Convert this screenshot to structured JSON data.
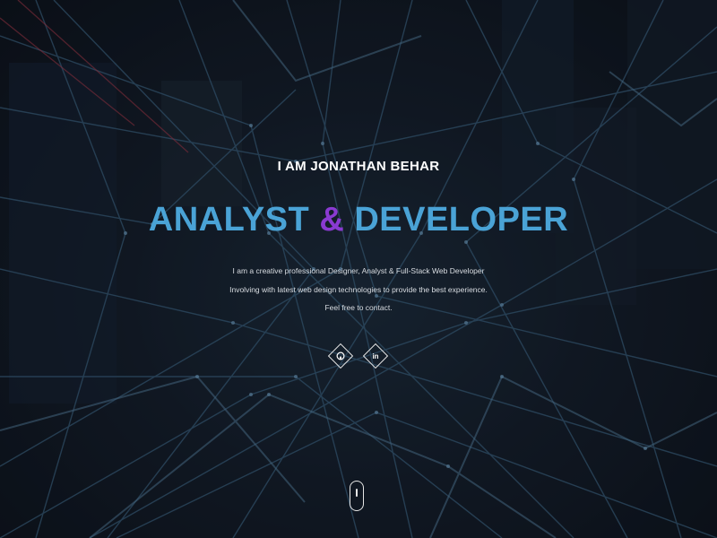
{
  "hero": {
    "intro": "I AM JONATHAN BEHAR",
    "headline_part1": "ANALYST",
    "headline_amp": "&",
    "headline_part2": "DEVELOPER",
    "description": [
      "I am a creative professional Designer, Analyst & Full-Stack Web Developer",
      "Involving with latest web design technologies to provide the best experience.",
      "Feel free to contact."
    ]
  },
  "social": [
    {
      "name": "github",
      "icon": "github-icon",
      "glyph": "◯"
    },
    {
      "name": "linkedin",
      "icon": "linkedin-icon",
      "glyph": "in"
    }
  ],
  "colors": {
    "accent_blue": "#4aa3d6",
    "accent_purple": "#8a3ad1",
    "text_white": "#ffffff",
    "background": "#10161f"
  },
  "icons": {
    "scroll": "mouse-scroll-icon"
  }
}
